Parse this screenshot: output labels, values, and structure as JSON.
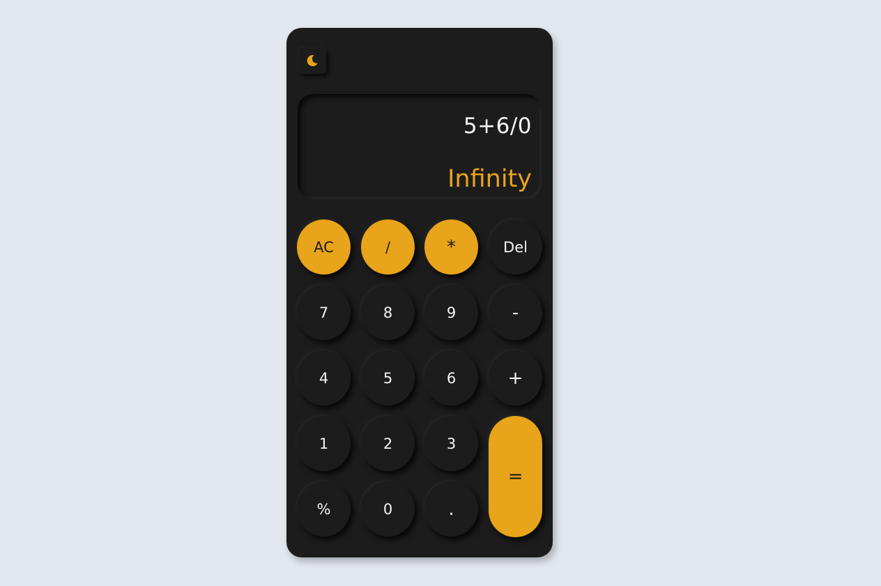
{
  "theme_toggle": {
    "icon": "moon-icon",
    "color": "#e8a41a"
  },
  "display": {
    "expression": "5+6/0",
    "result": "Infinity"
  },
  "keys": {
    "ac": "AC",
    "divide": "/",
    "multiply": "*",
    "del": "Del",
    "seven": "7",
    "eight": "8",
    "nine": "9",
    "minus": "-",
    "four": "4",
    "five": "5",
    "six": "6",
    "plus": "+",
    "one": "1",
    "two": "2",
    "three": "3",
    "equals": "=",
    "percent": "%",
    "zero": "0",
    "dot": "."
  },
  "colors": {
    "accent": "#e8a41a",
    "body": "#1c1c1c",
    "background": "#e3e7ef",
    "text": "#f4f4f4"
  }
}
